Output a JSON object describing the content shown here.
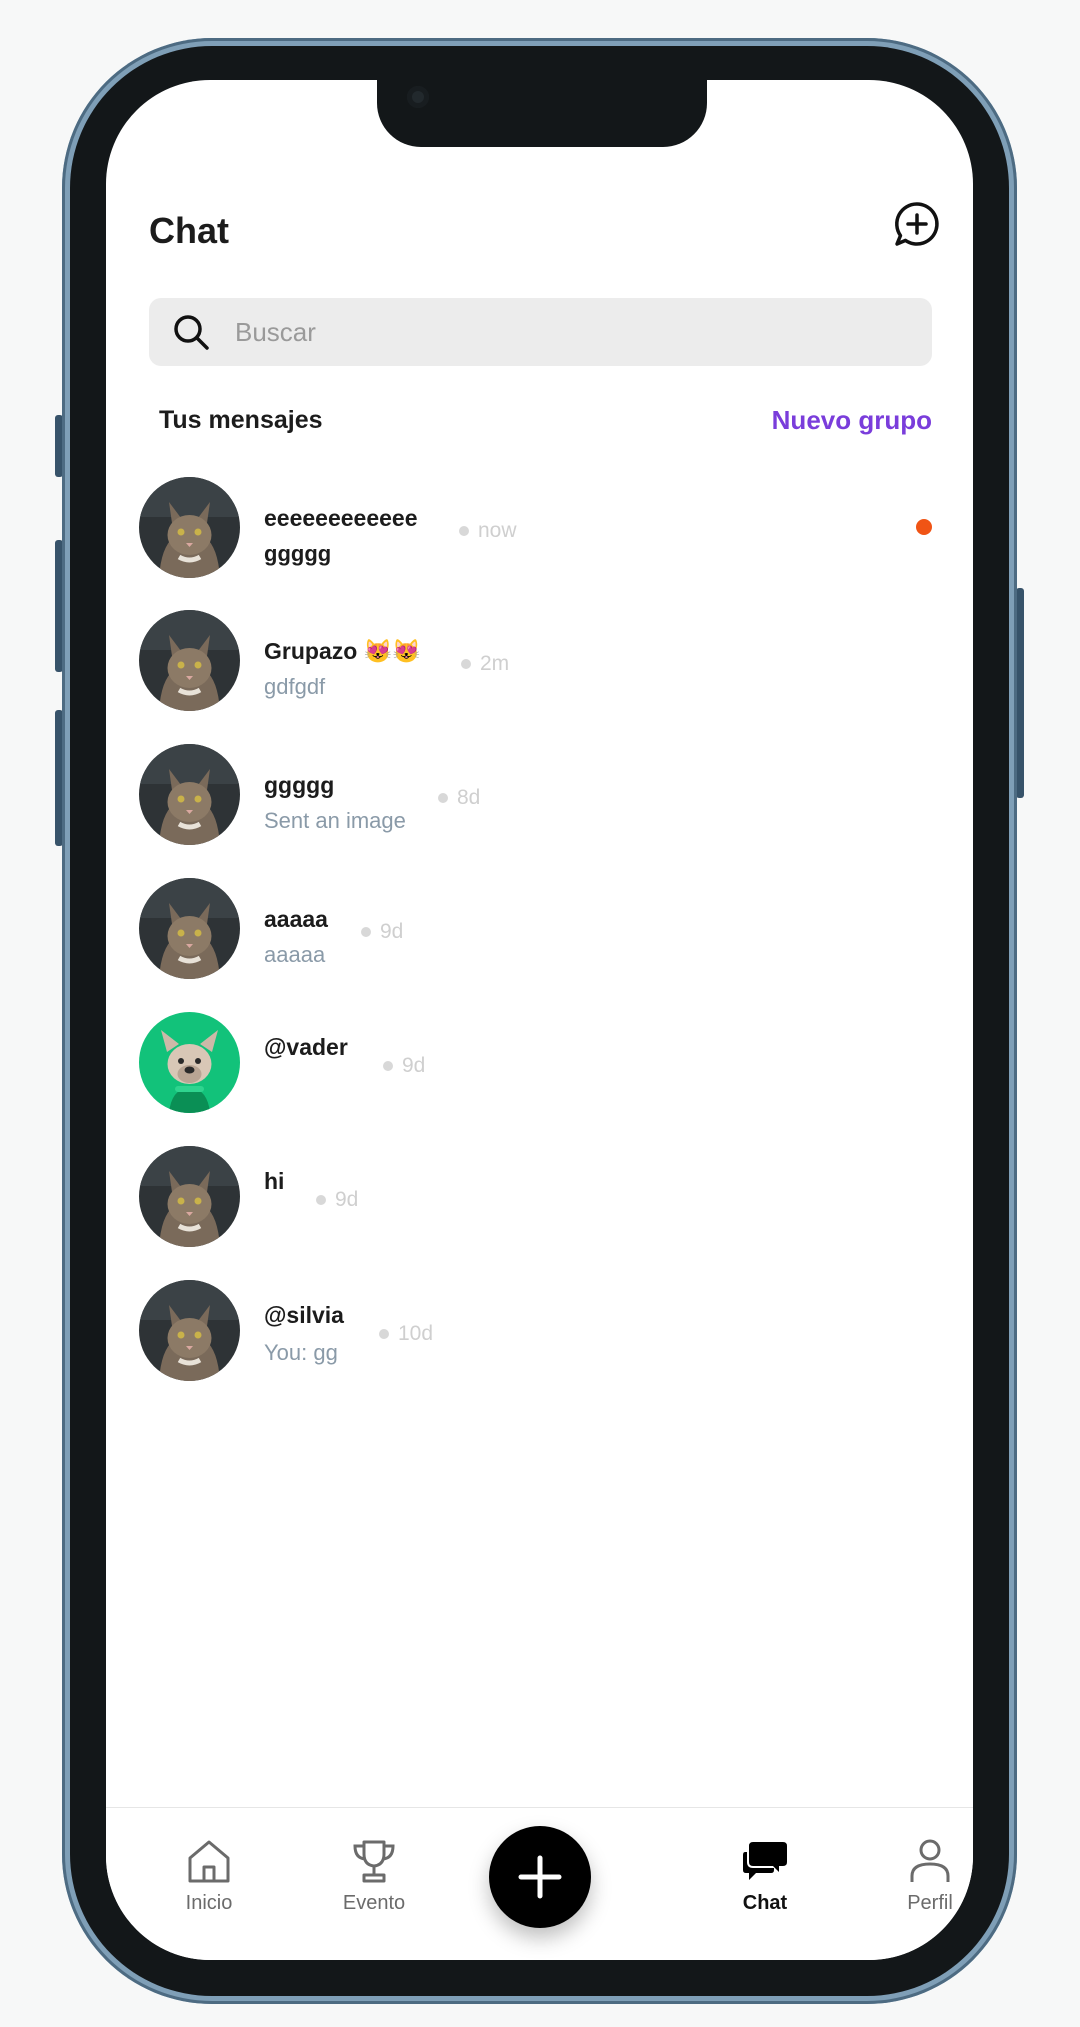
{
  "header": {
    "title": "Chat"
  },
  "search": {
    "placeholder": "Buscar"
  },
  "section": {
    "label": "Tus mensajes",
    "new_group": "Nuevo grupo"
  },
  "chats": [
    {
      "name": "eeeeeeeeeeee",
      "preview": "ggggg",
      "time": "now",
      "unread": true,
      "avatar": "cat-photo"
    },
    {
      "name": "Grupazo 😻😻",
      "preview": "gdfgdf",
      "time": "2m",
      "unread": false,
      "avatar": "cat-photo"
    },
    {
      "name": "ggggg",
      "preview": "Sent an image",
      "time": "8d",
      "unread": false,
      "avatar": "cat-photo"
    },
    {
      "name": "aaaaa",
      "preview": "aaaaa",
      "time": "9d",
      "unread": false,
      "avatar": "cat-photo"
    },
    {
      "name": "@vader",
      "preview": "",
      "time": "9d",
      "unread": false,
      "avatar": "dog-photo"
    },
    {
      "name": "hi",
      "preview": "",
      "time": "9d",
      "unread": false,
      "avatar": "cat-photo"
    },
    {
      "name": "@silvia",
      "preview": "You: gg",
      "time": "10d",
      "unread": false,
      "avatar": "cat-photo"
    }
  ],
  "nav": {
    "items": [
      {
        "label": "Inicio",
        "icon": "home-icon",
        "active": false
      },
      {
        "label": "Evento",
        "icon": "trophy-icon",
        "active": false
      },
      {
        "label": "Chat",
        "icon": "chat-bubbles-icon",
        "active": true
      },
      {
        "label": "Perfil",
        "icon": "person-icon",
        "active": false
      }
    ],
    "fab_icon": "plus-icon"
  },
  "colors": {
    "accent": "#7a3ddb",
    "unread": "#f05415",
    "dog_avatar_bg": "#12c27a"
  }
}
